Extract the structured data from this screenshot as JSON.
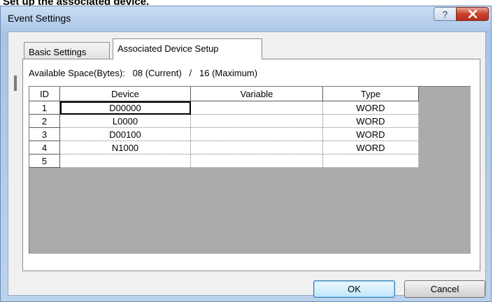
{
  "caption": "Set up the associated device.",
  "window": {
    "title": "Event Settings"
  },
  "titlebar": {
    "help_glyph": "?",
    "close_glyph": "✕"
  },
  "tabs": [
    {
      "label": "Basic Settings",
      "active": false
    },
    {
      "label": "Associated Device Setup",
      "active": true
    }
  ],
  "space": {
    "label": "Available Space(Bytes):",
    "current": "08 (Current)",
    "separator": "/",
    "maximum": "16 (Maximum)"
  },
  "grid": {
    "columns": [
      "ID",
      "Device",
      "Variable",
      "Type"
    ],
    "rows": [
      {
        "id": "1",
        "device": "D00000",
        "variable": "",
        "type": "WORD"
      },
      {
        "id": "2",
        "device": "L0000",
        "variable": "",
        "type": "WORD"
      },
      {
        "id": "3",
        "device": "D00100",
        "variable": "",
        "type": "WORD"
      },
      {
        "id": "4",
        "device": "N1000",
        "variable": "",
        "type": "WORD"
      },
      {
        "id": "5",
        "device": "",
        "variable": "",
        "type": ""
      }
    ]
  },
  "buttons": {
    "ok": "OK",
    "cancel": "Cancel"
  },
  "colors": {
    "title_bar": "#b9d1ee",
    "close_button": "#c8412b",
    "ok_border": "#3c7fb1"
  }
}
